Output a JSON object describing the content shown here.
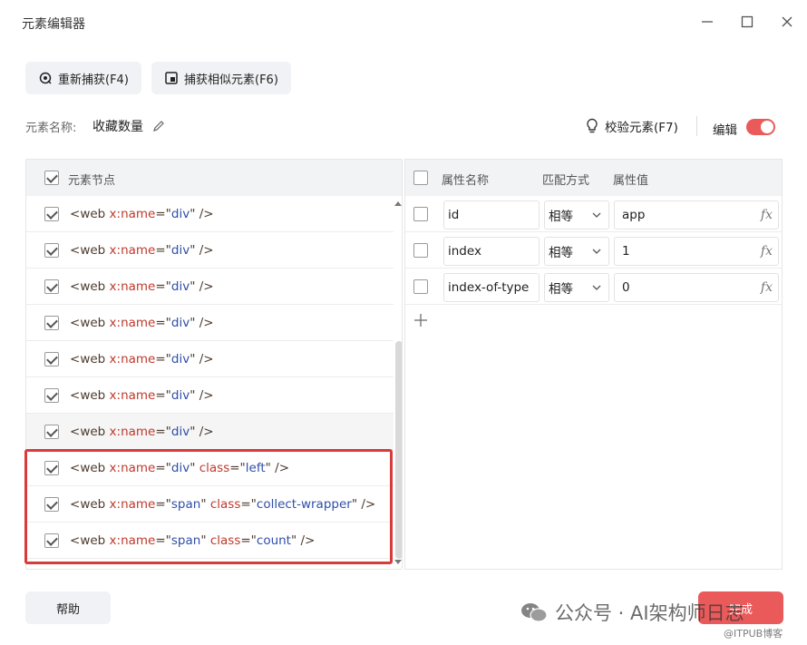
{
  "window": {
    "title": "元素编辑器"
  },
  "toolbar": {
    "recapture_label": "重新捕获(F4)",
    "capture_similar_label": "捕获相似元素(F6)"
  },
  "element_name": {
    "label": "元素名称:",
    "value": "收藏数量"
  },
  "validate_label": "校验元素(F7)",
  "edit_label": "编辑",
  "left_panel": {
    "header": "元素节点",
    "nodes": [
      {
        "tag": "web",
        "name": "div"
      },
      {
        "tag": "web",
        "name": "div"
      },
      {
        "tag": "web",
        "name": "div"
      },
      {
        "tag": "web",
        "name": "div"
      },
      {
        "tag": "web",
        "name": "div"
      },
      {
        "tag": "web",
        "name": "div"
      },
      {
        "tag": "web",
        "name": "div"
      },
      {
        "tag": "web",
        "name": "div",
        "class": "left"
      },
      {
        "tag": "web",
        "name": "span",
        "class": "collect-wrapper"
      },
      {
        "tag": "web",
        "name": "span",
        "class": "count"
      }
    ],
    "attr_name_key": "x:name",
    "attr_class_key": "class"
  },
  "right_panel": {
    "headers": [
      "属性名称",
      "匹配方式",
      "属性值"
    ],
    "rows": [
      {
        "name": "id",
        "match": "相等",
        "value": "app"
      },
      {
        "name": "index",
        "match": "相等",
        "value": "1"
      },
      {
        "name": "index-of-type",
        "match": "相等",
        "value": "0"
      }
    ],
    "fx_label": "fx",
    "add_label": "+"
  },
  "footer": {
    "help_label": "帮助",
    "done_label": "完成"
  },
  "watermark": {
    "text": "公众号 · AI架构师日志",
    "sub": "@ITPUB博客"
  },
  "colors": {
    "accent": "#ea5a5a",
    "highlight_box": "#d93a3a",
    "attr_name": "#c0392b",
    "attr_value": "#2f4fa8"
  }
}
